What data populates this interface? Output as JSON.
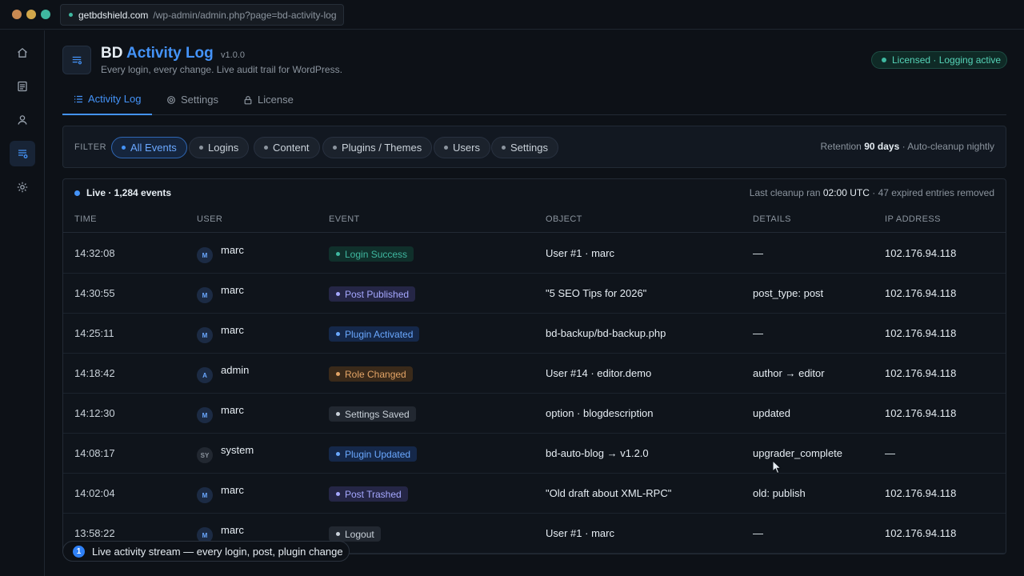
{
  "browser": {
    "host": "getbdshield.com",
    "path": "/wp-admin/admin.php?page=bd-activity-log",
    "traffic_colors": [
      "#c98a52",
      "#d2a74a",
      "#3fb8a0"
    ]
  },
  "sidebar": {
    "items": [
      {
        "icon": "home-icon"
      },
      {
        "icon": "posts-icon"
      },
      {
        "icon": "user-icon"
      },
      {
        "icon": "activity-log-icon",
        "active": true
      },
      {
        "icon": "gear-icon"
      }
    ]
  },
  "header": {
    "title_prefix": "BD",
    "title_accent": "Activity Log",
    "version": "v1.0.0",
    "subtitle": "Every login, every change. Live audit trail for WordPress.",
    "license_badge": "Licensed · Logging active"
  },
  "tabs": [
    {
      "label": "Activity Log",
      "icon": "list-icon",
      "active": true
    },
    {
      "label": "Settings",
      "icon": "gear-icon"
    },
    {
      "label": "License",
      "icon": "lock-icon"
    }
  ],
  "filter": {
    "label": "FILTER",
    "chips": [
      "All Events",
      "Logins",
      "Content",
      "Plugins / Themes",
      "Users",
      "Settings"
    ],
    "active_chip": "All Events",
    "retention_prefix": "Retention",
    "retention_value": "90 days",
    "retention_suffix": "· Auto-cleanup nightly"
  },
  "table": {
    "live_label": "Live · 1,284 events",
    "cleanup_prefix": "Last cleanup ran",
    "cleanup_time": "02:00 UTC",
    "cleanup_suffix": "· 47 expired entries removed",
    "columns": [
      "TIME",
      "USER",
      "EVENT",
      "OBJECT",
      "DETAILS",
      "IP ADDRESS"
    ],
    "rows": [
      {
        "time": "14:32:08",
        "avatar": "M",
        "user": "marc",
        "event": "Login Success",
        "event_color": "#3fb8a0",
        "event_bg": "#10302b",
        "object": "User #1 · marc",
        "details": "—",
        "ip": "102.176.94.118"
      },
      {
        "time": "14:30:55",
        "avatar": "M",
        "user": "marc",
        "event": "Post Published",
        "event_color": "#a5a8ff",
        "event_bg": "#252646",
        "object": "\"5 SEO Tips for 2026\"",
        "details": "post_type: post",
        "ip": "102.176.94.118"
      },
      {
        "time": "14:25:11",
        "avatar": "M",
        "user": "marc",
        "event": "Plugin Activated",
        "event_color": "#6aa8ff",
        "event_bg": "#15284a",
        "object": "bd-backup/bd-backup.php",
        "details": "—",
        "ip": "102.176.94.118"
      },
      {
        "time": "14:18:42",
        "avatar": "A",
        "user": "admin",
        "event": "Role Changed",
        "event_color": "#e3a466",
        "event_bg": "#3a2a1a",
        "object": "User #14 · editor.demo",
        "details": "author → editor",
        "ip": "102.176.94.118"
      },
      {
        "time": "14:12:30",
        "avatar": "M",
        "user": "marc",
        "event": "Settings Saved",
        "event_color": "#c9d1d9",
        "event_bg": "#222831",
        "object": "option · blogdescription",
        "details": "updated",
        "ip": "102.176.94.118"
      },
      {
        "time": "14:08:17",
        "avatar": "SY",
        "user": "system",
        "event": "Plugin Updated",
        "event_color": "#6aa8ff",
        "event_bg": "#15284a",
        "object": "bd-auto-blog → v1.2.0",
        "details": "upgrader_complete",
        "ip": "—"
      },
      {
        "time": "14:02:04",
        "avatar": "M",
        "user": "marc",
        "event": "Post Trashed",
        "event_color": "#a5a8ff",
        "event_bg": "#252646",
        "object": "\"Old draft about XML-RPC\"",
        "details": "old: publish",
        "ip": "102.176.94.118"
      },
      {
        "time": "13:58:22",
        "avatar": "M",
        "user": "marc",
        "event": "Logout",
        "event_color": "#c9d1d9",
        "event_bg": "#222831",
        "object": "User #1 · marc",
        "details": "—",
        "ip": "102.176.94.118"
      }
    ]
  },
  "tooltip": {
    "number": "1",
    "text": "Live activity stream — every login, post, plugin change"
  }
}
